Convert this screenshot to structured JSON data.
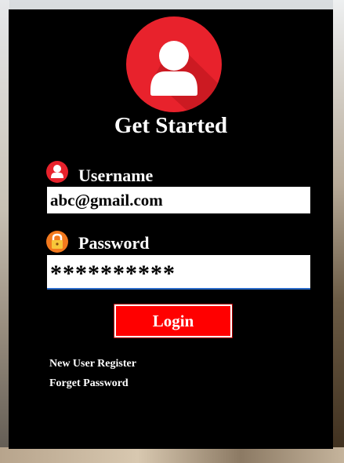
{
  "login": {
    "title": "Get Started",
    "username": {
      "label": "Username",
      "value": "abc@gmail.com",
      "icon": "user-icon"
    },
    "password": {
      "label": "Password",
      "value": "**********",
      "icon": "lock-icon"
    },
    "login_button": "Login",
    "links": {
      "register": "New User Register",
      "forget": "Forget Password"
    },
    "avatar_icon": "avatar-user-icon"
  },
  "colors": {
    "panel": "#000000",
    "accent_red": "#e8222c",
    "button_red": "#ff0000",
    "lock_orange": "#f2791e",
    "input_focus": "#2a6bc9"
  }
}
